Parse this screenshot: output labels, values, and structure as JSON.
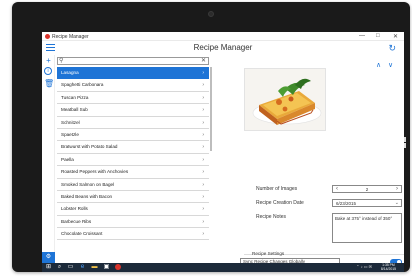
{
  "window": {
    "title": "Recipe Manager",
    "minimize": "—",
    "close": "✕"
  },
  "header": {
    "title": "Recipe Manager",
    "refresh_icon": "↻"
  },
  "search": {
    "value": "",
    "placeholder": ""
  },
  "recipes": [
    {
      "label": "Lasagna",
      "selected": true
    },
    {
      "label": "Spaghetti Carbonara"
    },
    {
      "label": "Tuscan Pizza"
    },
    {
      "label": "Meatball Sub"
    },
    {
      "label": "Schnitzel"
    },
    {
      "label": "Spaetzle"
    },
    {
      "label": "Bratwurst with Potato Salad"
    },
    {
      "label": "Paella"
    },
    {
      "label": "Roasted Peppers with Anchovies"
    },
    {
      "label": "Smoked Salmon on Bagel"
    },
    {
      "label": "Baked Beans with Bacon"
    },
    {
      "label": "Lobster Rolls"
    },
    {
      "label": "Barbecue Ribs"
    },
    {
      "label": "Chocolate Croissant"
    }
  ],
  "detail": {
    "num_images_label": "Number of Images",
    "num_images_value": "2",
    "creation_date_label": "Recipe Creation Date",
    "creation_date_value": "6/23/2015",
    "notes_label": "Recipe Notes",
    "notes_value": "Bake at 375° instead of 350°"
  },
  "settings": {
    "title": "Recipe Settings",
    "sync_label": "Sync Recipe Changes Globally",
    "sync_enabled": true
  },
  "taskbar": {
    "time": "1:35 PM",
    "date": "8/14/2015"
  },
  "colors": {
    "accent": "#1e74d6",
    "taskbar": "#1c2a3a",
    "app_icon": "#d9342b"
  }
}
